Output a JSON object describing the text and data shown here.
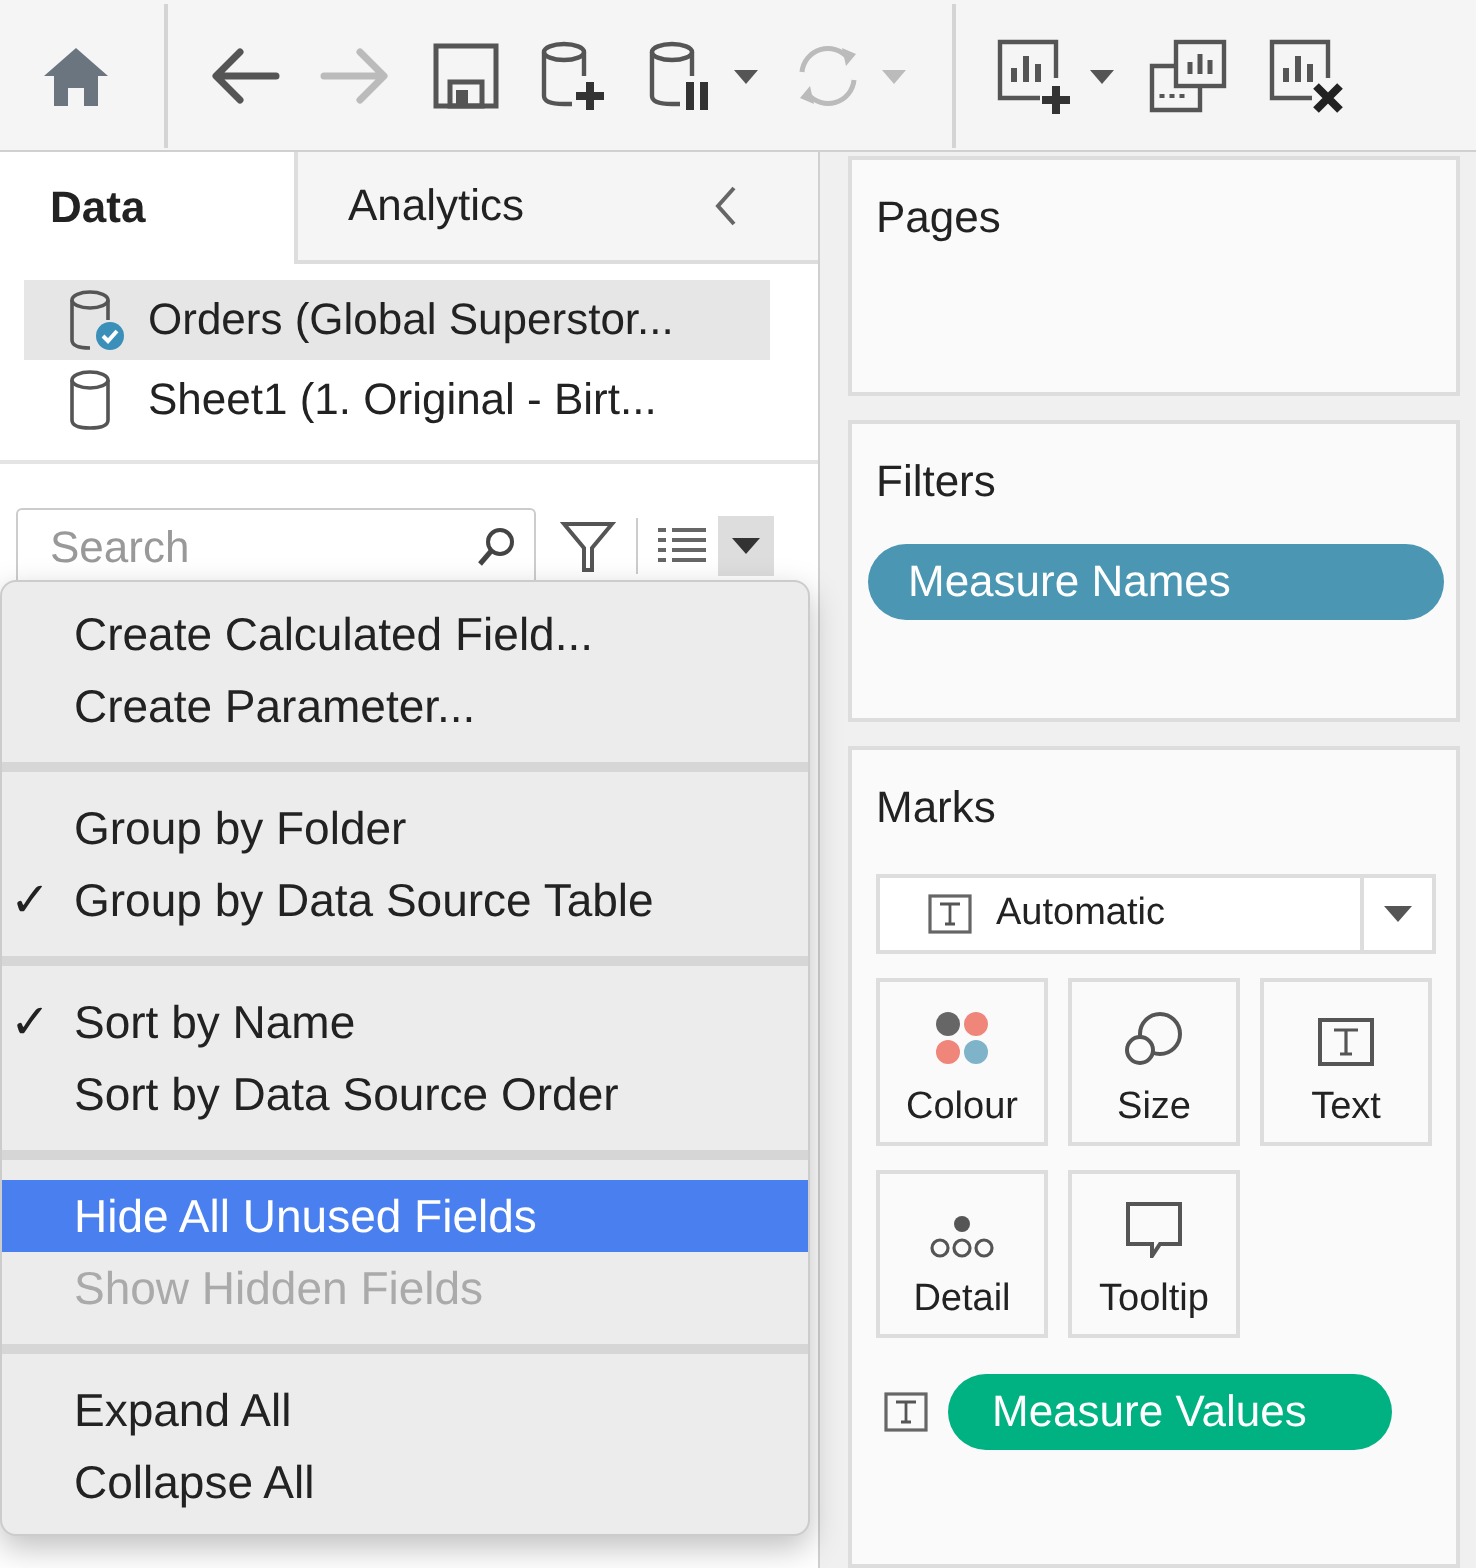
{
  "toolbar": [
    {
      "kind": "home",
      "disabled": false
    },
    {
      "kind": "divider"
    },
    {
      "kind": "back",
      "disabled": false
    },
    {
      "kind": "forward",
      "disabled": true
    },
    {
      "kind": "save",
      "disabled": false
    },
    {
      "kind": "add-source",
      "disabled": false
    },
    {
      "kind": "pause-source",
      "disabled": false
    },
    {
      "kind": "caret",
      "disabled": false
    },
    {
      "kind": "refresh",
      "disabled": true
    },
    {
      "kind": "caret",
      "disabled": true
    },
    {
      "kind": "divider"
    },
    {
      "kind": "new-sheet",
      "disabled": false
    },
    {
      "kind": "caret",
      "disabled": false
    },
    {
      "kind": "duplicate-sheet",
      "disabled": false
    },
    {
      "kind": "clear-sheet",
      "disabled": false
    }
  ],
  "data_pane": {
    "tabs": [
      {
        "label": "Data",
        "selected": true
      },
      {
        "label": "Analytics",
        "selected": false
      }
    ],
    "data_sources": [
      {
        "name": "Orders (Global Superstor...",
        "selected": true,
        "primary": true
      },
      {
        "name": "Sheet1 (1. Original - Birt...",
        "selected": false,
        "primary": false
      }
    ],
    "search": {
      "placeholder": "Search"
    }
  },
  "menu": {
    "sections": [
      [
        {
          "label": "Create Calculated Field...",
          "checked": false,
          "selected": false,
          "disabled": false
        },
        {
          "label": "Create Parameter...",
          "checked": false,
          "selected": false,
          "disabled": false
        }
      ],
      [
        {
          "label": "Group by Folder",
          "checked": false,
          "selected": false,
          "disabled": false
        },
        {
          "label": "Group by Data Source Table",
          "checked": true,
          "selected": false,
          "disabled": false
        }
      ],
      [
        {
          "label": "Sort by Name",
          "checked": true,
          "selected": false,
          "disabled": false
        },
        {
          "label": "Sort by Data Source Order",
          "checked": false,
          "selected": false,
          "disabled": false
        }
      ],
      [
        {
          "label": "Hide All Unused Fields",
          "checked": false,
          "selected": true,
          "disabled": false
        },
        {
          "label": "Show Hidden Fields",
          "checked": false,
          "selected": false,
          "disabled": true
        }
      ],
      [
        {
          "label": "Expand All",
          "checked": false,
          "selected": false,
          "disabled": false
        },
        {
          "label": "Collapse All",
          "checked": false,
          "selected": false,
          "disabled": false
        }
      ]
    ],
    "check_symbol": "✓"
  },
  "pages": {
    "title": "Pages"
  },
  "filters": {
    "title": "Filters",
    "pills": [
      {
        "label": "Measure Names",
        "color": "#4a96b3"
      }
    ]
  },
  "marks": {
    "title": "Marks",
    "mark_type": "Automatic",
    "buttons": [
      {
        "label": "Colour",
        "kind": "colour"
      },
      {
        "label": "Size",
        "kind": "size"
      },
      {
        "label": "Text",
        "kind": "text"
      },
      {
        "label": "Detail",
        "kind": "detail"
      },
      {
        "label": "Tooltip",
        "kind": "tooltip"
      }
    ],
    "pills": [
      {
        "label": "Measure Values",
        "color": "#00b181",
        "kind": "text"
      }
    ]
  }
}
